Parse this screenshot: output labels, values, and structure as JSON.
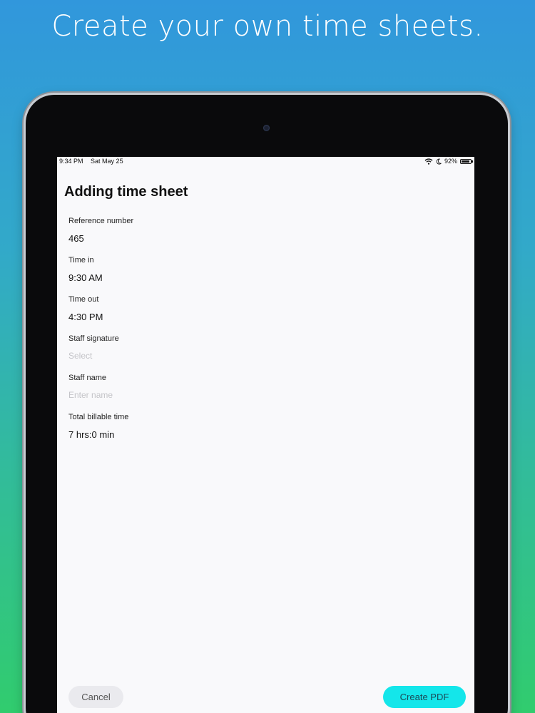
{
  "promo": {
    "headline": "Create your own time sheets."
  },
  "status_bar": {
    "time": "9:34 PM",
    "date": "Sat May 25",
    "battery": "92%",
    "battery_level": 0.92,
    "icons": [
      "wifi-icon",
      "moon-icon",
      "battery-icon"
    ]
  },
  "page": {
    "title": "Adding time sheet"
  },
  "form": {
    "fields": [
      {
        "label": "Reference number",
        "value": "465"
      },
      {
        "label": "Time in",
        "value": "9:30 AM"
      },
      {
        "label": "Time out",
        "value": "4:30 PM"
      },
      {
        "label": "Staff signature",
        "placeholder": "Select"
      },
      {
        "label": "Staff name",
        "placeholder": "Enter name"
      },
      {
        "label": "Total billable time",
        "value": "7 hrs:0 min"
      }
    ]
  },
  "actions": {
    "cancel_label": "Cancel",
    "create_pdf_label": "Create PDF"
  },
  "colors": {
    "gradient_top": "#3197dc",
    "gradient_bottom": "#31cc6e",
    "accent": "#14e6ea",
    "screen_bg": "#f9f9fb"
  }
}
